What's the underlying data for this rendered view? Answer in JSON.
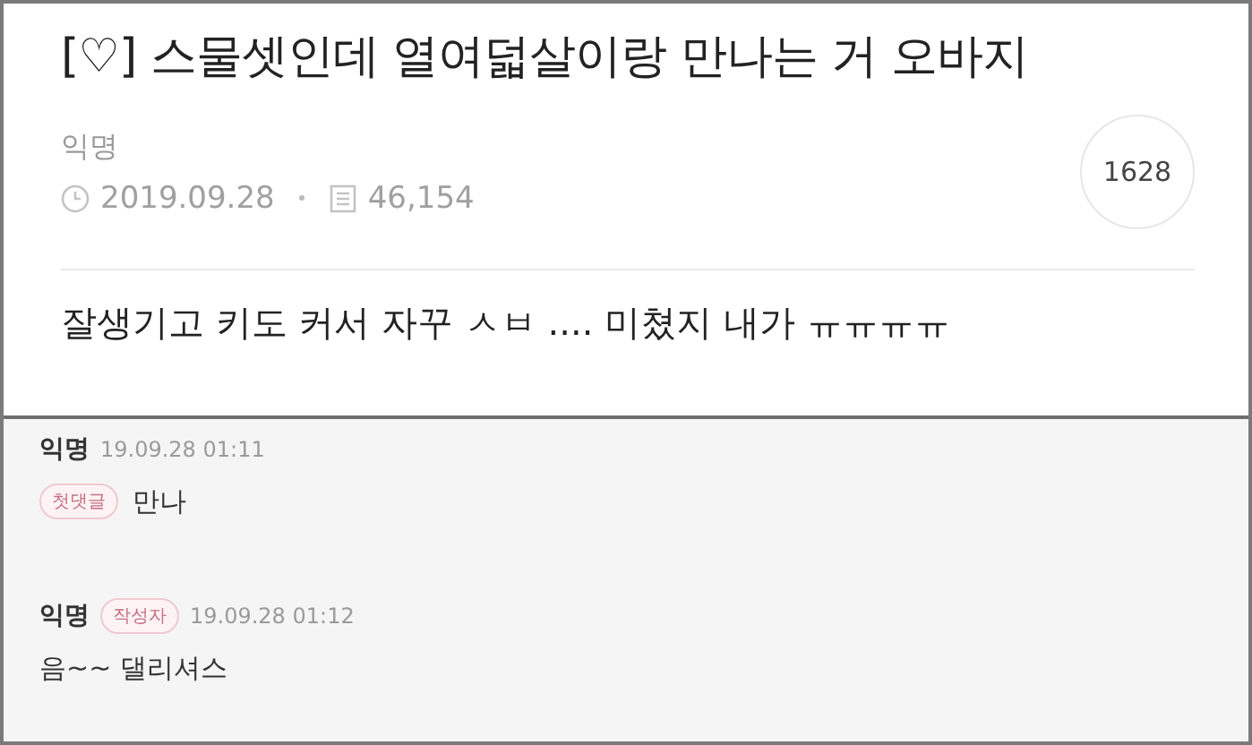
{
  "post": {
    "title": "[♡] 스물셋인데 열여덟살이랑 만나는 거 오바지",
    "author": "익명",
    "date": "2019.09.28",
    "views": "46,154",
    "count": "1628",
    "body": "잘생기고 키도 커서 자꾸 ㅅㅂ .... 미쳤지 내가 ㅠㅠㅠㅠ"
  },
  "comments": [
    {
      "author": "익명",
      "time": "19.09.28 01:11",
      "text_badge": "첫댓글",
      "text": "만나"
    },
    {
      "author": "익명",
      "author_badge": "작성자",
      "time": "19.09.28 01:12",
      "text": "음~~ 댈리셔스"
    }
  ]
}
